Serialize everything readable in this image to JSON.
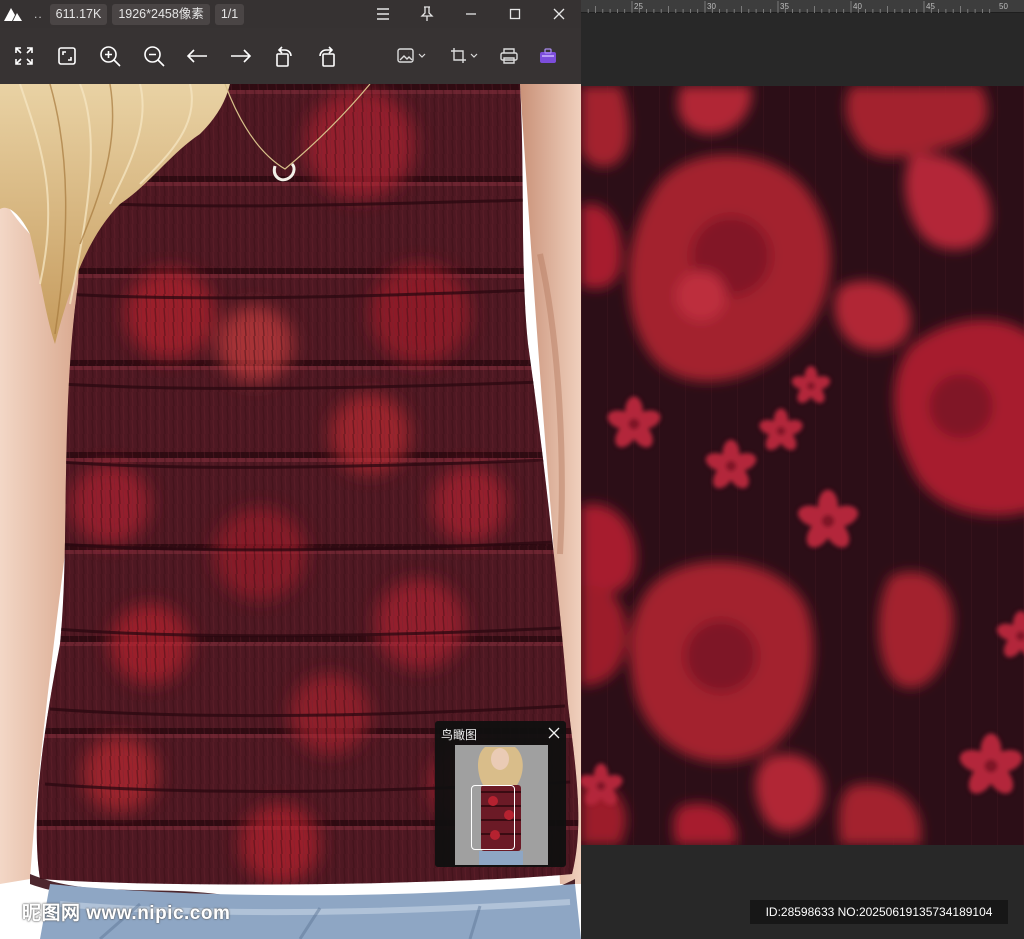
{
  "viewer": {
    "titlebar": {
      "dots": "..",
      "file_size": "611.17K",
      "dimensions": "1926*2458像素",
      "page_counter": "1/1",
      "buttons": [
        "menu-icon",
        "pin-icon",
        "minimize-icon",
        "maximize-icon",
        "close-icon"
      ]
    },
    "toolbar": {
      "tools": [
        "fullscreen-icon",
        "fit-window-icon",
        "zoom-in-icon",
        "zoom-out-icon",
        "previous-icon",
        "next-icon",
        "rotate-left-icon",
        "rotate-right-icon",
        "edit-image-icon",
        "crop-icon",
        "print-icon",
        "toolbox-icon"
      ]
    },
    "navigator": {
      "title": "鸟瞰图"
    },
    "watermark": "昵图网 www.nipic.com"
  },
  "editor": {
    "ruler_ticks": [
      "25",
      "30",
      "35",
      "40",
      "45",
      "50"
    ],
    "id_label": "ID:28598633 NO:20250619135734189104"
  },
  "colors": {
    "titlebar_bg": "#2e2a2a",
    "toolbar_bg": "#2c2828",
    "pattern_bg": "#2c0e17",
    "flower_red": "#a8202f",
    "fabric_dark": "#4e1822",
    "editor_bg": "#282828",
    "toolbox_accent": "#8b5cf6"
  }
}
